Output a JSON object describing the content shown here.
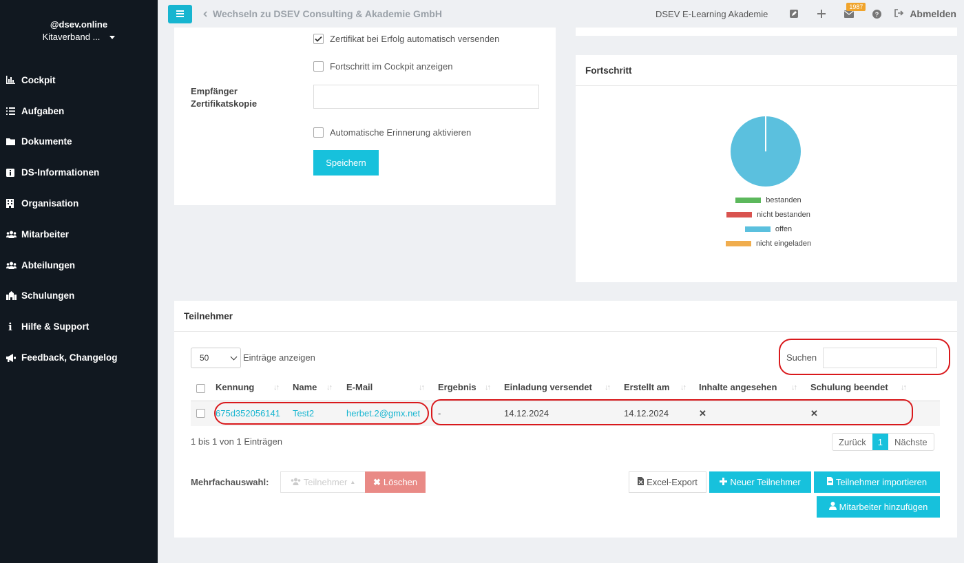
{
  "sidebar": {
    "user_name": "@dsev.online",
    "org": "Kitaverband ...",
    "items": [
      {
        "label": "Cockpit",
        "icon": "chart-icon"
      },
      {
        "label": "Aufgaben",
        "icon": "list-icon"
      },
      {
        "label": "Dokumente",
        "icon": "folder-icon"
      },
      {
        "label": "DS-Informationen",
        "icon": "info-icon"
      },
      {
        "label": "Organisation",
        "icon": "building-icon"
      },
      {
        "label": "Mitarbeiter",
        "icon": "users-icon"
      },
      {
        "label": "Abteilungen",
        "icon": "users-icon"
      },
      {
        "label": "Schulungen",
        "icon": "school-icon"
      },
      {
        "label": "Hilfe & Support",
        "icon": "info-icon"
      },
      {
        "label": "Feedback, Changelog",
        "icon": "megaphone-icon"
      }
    ]
  },
  "topbar": {
    "switch_label": "Wechseln zu DSEV Consulting & Akademie GmbH",
    "academy": "DSEV E-Learning Akademie",
    "badge_count": "1987",
    "logout": "Abmelden"
  },
  "form": {
    "cert_auto_send": "Zertifikat bei Erfolg automatisch versenden",
    "cert_auto_send_checked": true,
    "show_progress": "Fortschritt im Cockpit anzeigen",
    "recipient_label_line1": "Empfänger",
    "recipient_label_line2": "Zertifikatskopie",
    "recipient_value": "",
    "auto_reminder": "Automatische Erinnerung aktivieren",
    "save": "Speichern"
  },
  "progress": {
    "title": "Fortschritt",
    "legend": [
      {
        "label": "bestanden",
        "color": "#5cb85c"
      },
      {
        "label": "nicht bestanden",
        "color": "#d9534f"
      },
      {
        "label": "offen",
        "color": "#5bc0de"
      },
      {
        "label": "nicht eingeladen",
        "color": "#f0ad4e"
      }
    ]
  },
  "chart_data": {
    "type": "pie",
    "categories": [
      "bestanden",
      "nicht bestanden",
      "offen",
      "nicht eingeladen"
    ],
    "values": [
      0,
      0,
      1,
      0
    ],
    "colors": [
      "#5cb85c",
      "#d9534f",
      "#5bc0de",
      "#f0ad4e"
    ],
    "legend_position": "bottom"
  },
  "participants": {
    "title": "Teilnehmer",
    "page_length": "50",
    "page_length_label": "Einträge anzeigen",
    "search_label": "Suchen",
    "search_value": "",
    "columns": [
      "Kennung",
      "Name",
      "E-Mail",
      "Ergebnis",
      "Einladung versendet",
      "Erstellt am",
      "Inhalte angesehen",
      "Schulung beendet"
    ],
    "rows": [
      {
        "kennung": "675d352056141",
        "name": "Test2",
        "email": "herbet.2@gmx.net",
        "ergebnis": "-",
        "einladung": "14.12.2024",
        "erstellt": "14.12.2024",
        "inhalte": "✕",
        "beendet": "✕"
      }
    ],
    "info": "1 bis 1 von 1 Einträgen",
    "pager": {
      "prev": "Zurück",
      "current": "1",
      "next": "Nächste"
    },
    "multi_label": "Mehrfachauswahl:",
    "btn_teilnehmer": "Teilnehmer",
    "btn_delete": "Löschen",
    "btn_excel": "Excel-Export",
    "btn_new": "Neuer Teilnehmer",
    "btn_import": "Teilnehmer importieren",
    "btn_add_staff": "Mitarbeiter hinzufügen"
  }
}
